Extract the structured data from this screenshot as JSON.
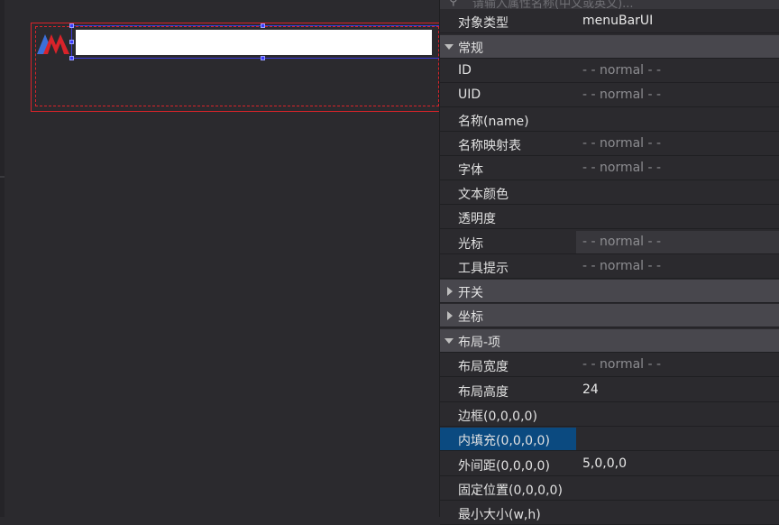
{
  "canvas": {
    "logo_colors": {
      "blue": "#3b6fd8",
      "red": "#d8232a"
    },
    "selection_color": "#3b3bff",
    "frame_color": "#d8232a"
  },
  "panel": {
    "search_placeholder": "请输入属性名称(中文或英文)...",
    "object_type": {
      "label": "对象类型",
      "value": "menuBarUI"
    },
    "sections": {
      "general": "常规",
      "switch": "开关",
      "coords": "坐标",
      "layout_item": "布局-项"
    },
    "general_rows": [
      {
        "label": "ID",
        "value": "- - normal - -"
      },
      {
        "label": "UID",
        "value": "- - normal - -"
      },
      {
        "label": "名称(name)",
        "value": ""
      },
      {
        "label": "名称映射表",
        "value": "- - normal - -"
      },
      {
        "label": "字体",
        "value": "- - normal - -"
      },
      {
        "label": "文本颜色",
        "value": ""
      },
      {
        "label": "透明度",
        "value": ""
      },
      {
        "label": "光标",
        "value": "- - normal - -"
      },
      {
        "label": "工具提示",
        "value": "- - normal - -"
      }
    ],
    "layout_rows": [
      {
        "label": "布局宽度",
        "value": "- - normal - -"
      },
      {
        "label": "布局高度",
        "value": "24"
      },
      {
        "label": "边框(0,0,0,0)",
        "value": ""
      },
      {
        "label": "内填充(0,0,0,0)",
        "value": ""
      },
      {
        "label": "外间距(0,0,0,0)",
        "value": "5,0,0,0"
      },
      {
        "label": "固定位置(0,0,0,0)",
        "value": ""
      },
      {
        "label": "最小大小(w,h)",
        "value": ""
      }
    ]
  }
}
